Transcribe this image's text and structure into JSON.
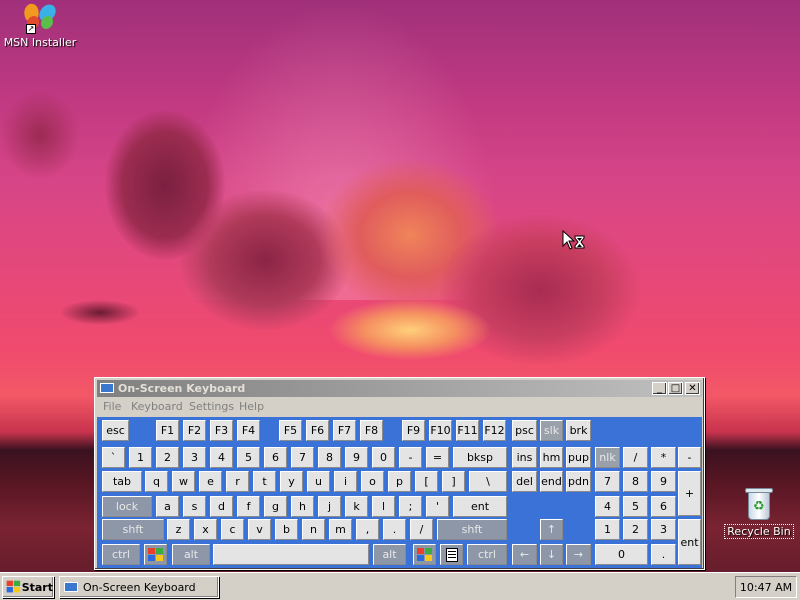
{
  "desktop": {
    "icons": [
      {
        "label": "MSN Installer"
      },
      {
        "label": "Recycle Bin"
      }
    ]
  },
  "osk_window": {
    "title": "On-Screen Keyboard",
    "controls": {
      "minimize": "_",
      "maximize": "□",
      "close": "✕"
    },
    "menu": [
      "File",
      "Keyboard",
      "Settings",
      "Help"
    ],
    "keys": {
      "esc": "esc",
      "f": [
        "F1",
        "F2",
        "F3",
        "F4",
        "F5",
        "F6",
        "F7",
        "F8",
        "F9",
        "F10",
        "F11",
        "F12"
      ],
      "psc": "psc",
      "slk": "slk",
      "brk": "brk",
      "row1": [
        "`",
        "1",
        "2",
        "3",
        "4",
        "5",
        "6",
        "7",
        "8",
        "9",
        "0",
        "-",
        "="
      ],
      "bksp": "bksp",
      "ins": "ins",
      "hm": "hm",
      "pup": "pup",
      "nlk": "nlk",
      "slash": "/",
      "star": "*",
      "minus": "-",
      "tab": "tab",
      "row2": [
        "q",
        "w",
        "e",
        "r",
        "t",
        "y",
        "u",
        "i",
        "o",
        "p",
        "[",
        "]",
        "\\"
      ],
      "del": "del",
      "end": "end",
      "pdn": "pdn",
      "n7": "7",
      "n8": "8",
      "n9": "9",
      "plus": "+",
      "lock": "lock",
      "row3": [
        "a",
        "s",
        "d",
        "f",
        "g",
        "h",
        "j",
        "k",
        "l",
        ";",
        "'"
      ],
      "ent": "ent",
      "n4": "4",
      "n5": "5",
      "n6": "6",
      "shft": "shft",
      "row4": [
        "z",
        "x",
        "c",
        "v",
        "b",
        "n",
        "m",
        ",",
        ".",
        "/"
      ],
      "up": "↑",
      "n1": "1",
      "n2": "2",
      "n3": "3",
      "ctrl": "ctrl",
      "alt": "alt",
      "left": "←",
      "down": "↓",
      "right": "→",
      "n0": "0",
      "dot": ".",
      "nent": "ent"
    }
  },
  "taskbar": {
    "start_label": "Start",
    "tasks": [
      {
        "label": "On-Screen Keyboard"
      }
    ],
    "clock": "10:47 AM"
  }
}
